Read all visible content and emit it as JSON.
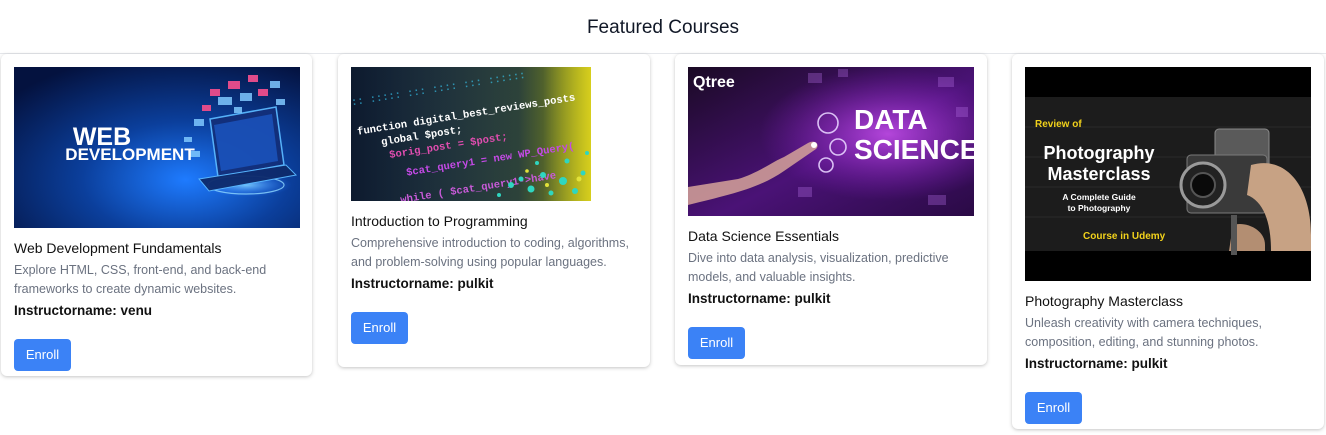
{
  "header": {
    "title": "Featured Courses"
  },
  "courses": [
    {
      "image_text": [
        "WEB",
        "DEVELOPMENT"
      ],
      "title": "Web Development Fundamentals",
      "description": "Explore HTML, CSS, front-end, and back-end frameworks to create dynamic websites.",
      "instructor_label": "Instructorname:",
      "instructor": "venu",
      "button": "Enroll"
    },
    {
      "image_text": [
        "function digital_best_reviews_posts",
        "global $post;",
        "$orig_post = $post;",
        "$cat_query1 = new WP_Query(",
        "while ( $cat_query1->have"
      ],
      "title": "Introduction to Programming",
      "description": "Comprehensive introduction to coding, algorithms, and problem-solving using popular languages.",
      "instructor_label": "Instructorname:",
      "instructor": "pulkit",
      "button": "Enroll"
    },
    {
      "image_text": [
        "Qtree",
        "DATA",
        "SCIENCE"
      ],
      "title": "Data Science Essentials",
      "description": "Dive into data analysis, visualization, predictive models, and valuable insights.",
      "instructor_label": "Instructorname:",
      "instructor": "pulkit",
      "button": "Enroll"
    },
    {
      "image_text": [
        "Review of",
        "Photography",
        "Masterclass",
        "A Complete Guide",
        "to Photography",
        "Course in Udemy"
      ],
      "title": "Photography Masterclass",
      "description": "Unleash creativity with camera techniques, composition, editing, and stunning photos.",
      "instructor_label": "Instructorname:",
      "instructor": "pulkit",
      "button": "Enroll"
    }
  ],
  "colors": {
    "accent": "#3b82f6",
    "muted_text": "#6b7280"
  }
}
